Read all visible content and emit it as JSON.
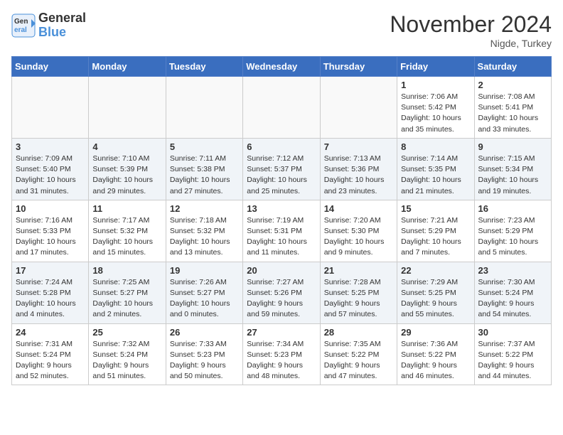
{
  "header": {
    "logo_line1": "General",
    "logo_line2": "Blue",
    "month": "November 2024",
    "location": "Nigde, Turkey"
  },
  "weekdays": [
    "Sunday",
    "Monday",
    "Tuesday",
    "Wednesday",
    "Thursday",
    "Friday",
    "Saturday"
  ],
  "weeks": [
    [
      {
        "day": "",
        "info": ""
      },
      {
        "day": "",
        "info": ""
      },
      {
        "day": "",
        "info": ""
      },
      {
        "day": "",
        "info": ""
      },
      {
        "day": "",
        "info": ""
      },
      {
        "day": "1",
        "info": "Sunrise: 7:06 AM\nSunset: 5:42 PM\nDaylight: 10 hours\nand 35 minutes."
      },
      {
        "day": "2",
        "info": "Sunrise: 7:08 AM\nSunset: 5:41 PM\nDaylight: 10 hours\nand 33 minutes."
      }
    ],
    [
      {
        "day": "3",
        "info": "Sunrise: 7:09 AM\nSunset: 5:40 PM\nDaylight: 10 hours\nand 31 minutes."
      },
      {
        "day": "4",
        "info": "Sunrise: 7:10 AM\nSunset: 5:39 PM\nDaylight: 10 hours\nand 29 minutes."
      },
      {
        "day": "5",
        "info": "Sunrise: 7:11 AM\nSunset: 5:38 PM\nDaylight: 10 hours\nand 27 minutes."
      },
      {
        "day": "6",
        "info": "Sunrise: 7:12 AM\nSunset: 5:37 PM\nDaylight: 10 hours\nand 25 minutes."
      },
      {
        "day": "7",
        "info": "Sunrise: 7:13 AM\nSunset: 5:36 PM\nDaylight: 10 hours\nand 23 minutes."
      },
      {
        "day": "8",
        "info": "Sunrise: 7:14 AM\nSunset: 5:35 PM\nDaylight: 10 hours\nand 21 minutes."
      },
      {
        "day": "9",
        "info": "Sunrise: 7:15 AM\nSunset: 5:34 PM\nDaylight: 10 hours\nand 19 minutes."
      }
    ],
    [
      {
        "day": "10",
        "info": "Sunrise: 7:16 AM\nSunset: 5:33 PM\nDaylight: 10 hours\nand 17 minutes."
      },
      {
        "day": "11",
        "info": "Sunrise: 7:17 AM\nSunset: 5:32 PM\nDaylight: 10 hours\nand 15 minutes."
      },
      {
        "day": "12",
        "info": "Sunrise: 7:18 AM\nSunset: 5:32 PM\nDaylight: 10 hours\nand 13 minutes."
      },
      {
        "day": "13",
        "info": "Sunrise: 7:19 AM\nSunset: 5:31 PM\nDaylight: 10 hours\nand 11 minutes."
      },
      {
        "day": "14",
        "info": "Sunrise: 7:20 AM\nSunset: 5:30 PM\nDaylight: 10 hours\nand 9 minutes."
      },
      {
        "day": "15",
        "info": "Sunrise: 7:21 AM\nSunset: 5:29 PM\nDaylight: 10 hours\nand 7 minutes."
      },
      {
        "day": "16",
        "info": "Sunrise: 7:23 AM\nSunset: 5:29 PM\nDaylight: 10 hours\nand 5 minutes."
      }
    ],
    [
      {
        "day": "17",
        "info": "Sunrise: 7:24 AM\nSunset: 5:28 PM\nDaylight: 10 hours\nand 4 minutes."
      },
      {
        "day": "18",
        "info": "Sunrise: 7:25 AM\nSunset: 5:27 PM\nDaylight: 10 hours\nand 2 minutes."
      },
      {
        "day": "19",
        "info": "Sunrise: 7:26 AM\nSunset: 5:27 PM\nDaylight: 10 hours\nand 0 minutes."
      },
      {
        "day": "20",
        "info": "Sunrise: 7:27 AM\nSunset: 5:26 PM\nDaylight: 9 hours\nand 59 minutes."
      },
      {
        "day": "21",
        "info": "Sunrise: 7:28 AM\nSunset: 5:25 PM\nDaylight: 9 hours\nand 57 minutes."
      },
      {
        "day": "22",
        "info": "Sunrise: 7:29 AM\nSunset: 5:25 PM\nDaylight: 9 hours\nand 55 minutes."
      },
      {
        "day": "23",
        "info": "Sunrise: 7:30 AM\nSunset: 5:24 PM\nDaylight: 9 hours\nand 54 minutes."
      }
    ],
    [
      {
        "day": "24",
        "info": "Sunrise: 7:31 AM\nSunset: 5:24 PM\nDaylight: 9 hours\nand 52 minutes."
      },
      {
        "day": "25",
        "info": "Sunrise: 7:32 AM\nSunset: 5:24 PM\nDaylight: 9 hours\nand 51 minutes."
      },
      {
        "day": "26",
        "info": "Sunrise: 7:33 AM\nSunset: 5:23 PM\nDaylight: 9 hours\nand 50 minutes."
      },
      {
        "day": "27",
        "info": "Sunrise: 7:34 AM\nSunset: 5:23 PM\nDaylight: 9 hours\nand 48 minutes."
      },
      {
        "day": "28",
        "info": "Sunrise: 7:35 AM\nSunset: 5:22 PM\nDaylight: 9 hours\nand 47 minutes."
      },
      {
        "day": "29",
        "info": "Sunrise: 7:36 AM\nSunset: 5:22 PM\nDaylight: 9 hours\nand 46 minutes."
      },
      {
        "day": "30",
        "info": "Sunrise: 7:37 AM\nSunset: 5:22 PM\nDaylight: 9 hours\nand 44 minutes."
      }
    ]
  ]
}
